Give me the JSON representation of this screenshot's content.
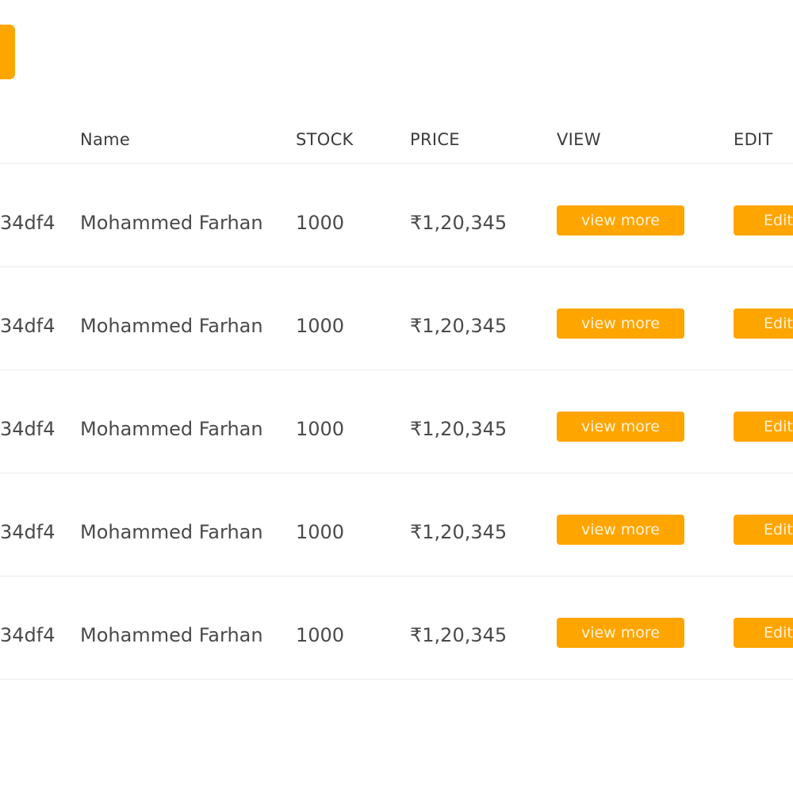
{
  "colors": {
    "accent": "#ffa500",
    "text": "#4a4a4a",
    "divider": "#ececec"
  },
  "table": {
    "headers": {
      "name": "Name",
      "stock": "STOCK",
      "price": "PRICE",
      "view": "VIEW",
      "edit": "EDIT"
    },
    "rows": [
      {
        "id": "34df4",
        "name": "Mohammed Farhan",
        "stock": "1000",
        "price": "₹1,20,345",
        "view_label": "view more",
        "edit_label": "Edit"
      },
      {
        "id": "34df4",
        "name": "Mohammed Farhan",
        "stock": "1000",
        "price": "₹1,20,345",
        "view_label": "view more",
        "edit_label": "Edit"
      },
      {
        "id": "34df4",
        "name": "Mohammed Farhan",
        "stock": "1000",
        "price": "₹1,20,345",
        "view_label": "view more",
        "edit_label": "Edit"
      },
      {
        "id": "34df4",
        "name": "Mohammed Farhan",
        "stock": "1000",
        "price": "₹1,20,345",
        "view_label": "view more",
        "edit_label": "Edit"
      },
      {
        "id": "34df4",
        "name": "Mohammed Farhan",
        "stock": "1000",
        "price": "₹1,20,345",
        "view_label": "view more",
        "edit_label": "Edit"
      }
    ]
  }
}
